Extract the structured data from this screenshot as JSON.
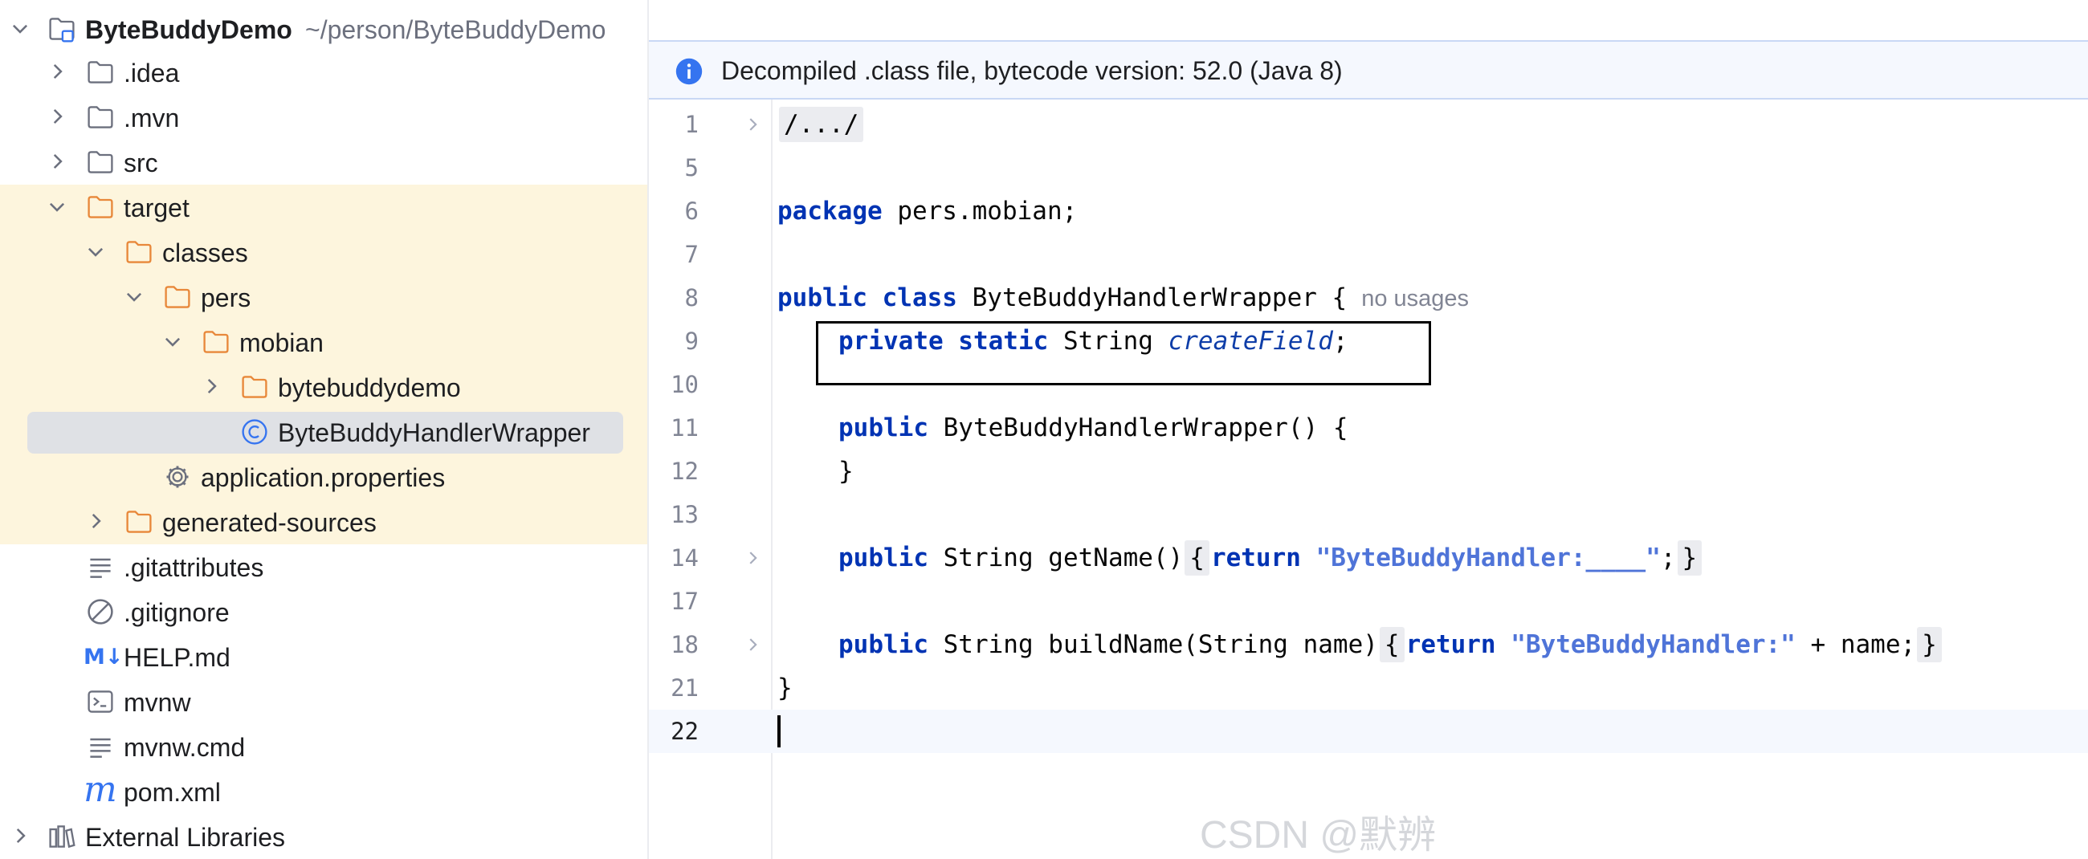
{
  "tree": {
    "root": {
      "name": "ByteBuddyDemo",
      "path": "~/person/ByteBuddyDemo"
    },
    "items": [
      {
        "label": ".idea"
      },
      {
        "label": ".mvn"
      },
      {
        "label": "src"
      },
      {
        "label": "target"
      },
      {
        "label": "classes"
      },
      {
        "label": "pers"
      },
      {
        "label": "mobian"
      },
      {
        "label": "bytebuddydemo"
      },
      {
        "label": "ByteBuddyHandlerWrapper"
      },
      {
        "label": "application.properties"
      },
      {
        "label": "generated-sources"
      },
      {
        "label": ".gitattributes"
      },
      {
        "label": ".gitignore"
      },
      {
        "label": "HELP.md",
        "icon_text": "M↓"
      },
      {
        "label": "mvnw"
      },
      {
        "label": "mvnw.cmd"
      },
      {
        "label": "pom.xml",
        "icon_text": "m"
      },
      {
        "label": "External Libraries"
      }
    ]
  },
  "editor": {
    "banner": "Decompiled .class file, bytecode version: 52.0 (Java 8)",
    "line_numbers": [
      "1",
      "5",
      "6",
      "7",
      "8",
      "9",
      "10",
      "11",
      "12",
      "13",
      "14",
      "17",
      "18",
      "21",
      "22"
    ],
    "tokens": {
      "l1_fold": "/.../",
      "l6_kw": "package",
      "l6_rest": " pers.mobian;",
      "l8_kw": "public class",
      "l8_rest": " ByteBuddyHandlerWrapper {",
      "l8_hint": "no usages",
      "l9_kw": "private static",
      "l9_type": " String ",
      "l9_field": "createField",
      "l9_end": ";",
      "l11_kw": "public",
      "l11_rest": " ByteBuddyHandlerWrapper() {",
      "l12": "}",
      "l14_kw": "public",
      "l14_rest": " String getName()",
      "l14_ob": "{",
      "l14_ret": "return",
      "l14_str": "\"ByteBuddyHandler:____\"",
      "l14_semi": ";",
      "l14_cb": "}",
      "l18_kw": "public",
      "l18_rest": " String buildName(String name)",
      "l18_ob": "{",
      "l18_ret": "return",
      "l18_str": "\"ByteBuddyHandler:\"",
      "l18_rest2": " + name;",
      "l18_cb": "}",
      "l21": "}"
    }
  },
  "watermark": "CSDN @默辨",
  "colors": {
    "keyword": "#0033b3",
    "string": "#4f74d8",
    "highlight_row": "#fdf5dd",
    "selection": "#dfe1e5",
    "folder_orange": "#e8883a"
  }
}
